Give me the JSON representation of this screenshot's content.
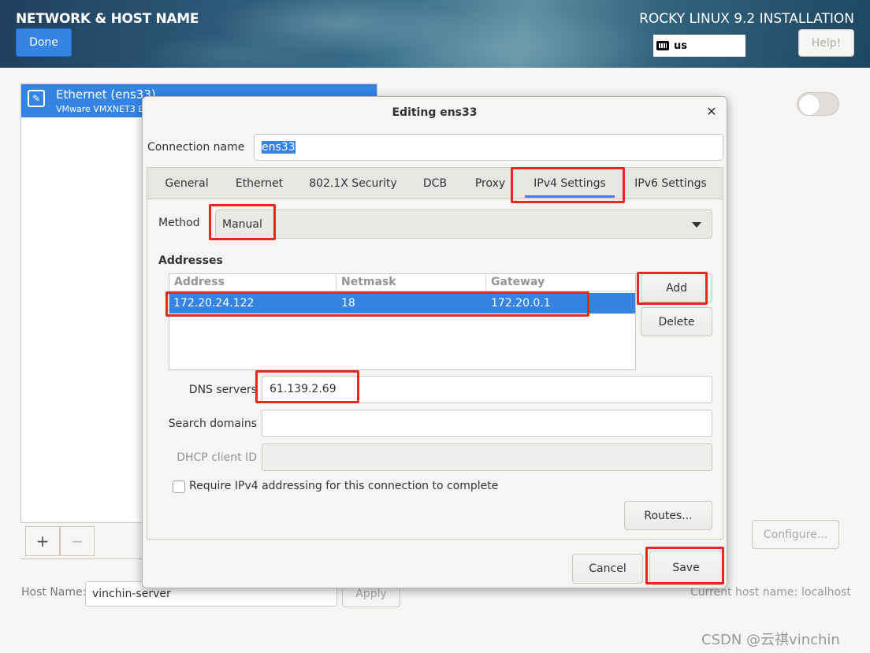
{
  "header": {
    "spoke_title": "NETWORK & HOST NAME",
    "done_label": "Done",
    "install_title": "ROCKY LINUX 9.2 INSTALLATION",
    "keyboard_layout": "us",
    "help_label": "Help!"
  },
  "device_list": {
    "items": [
      {
        "name": "Ethernet (ens33)",
        "description": "VMware VMXNET3 E"
      }
    ],
    "add_label": "+",
    "remove_label": "−"
  },
  "configure_label": "Configure...",
  "hostname": {
    "label": "Host Name:",
    "value": "vinchin-server",
    "apply_label": "Apply",
    "current_label": "Current host name:",
    "current_value": "localhost"
  },
  "dialog": {
    "title": "Editing ens33",
    "close_label": "✕",
    "connection_name_label": "Connection name",
    "connection_name_value": "ens33",
    "tabs": [
      {
        "label": "General"
      },
      {
        "label": "Ethernet"
      },
      {
        "label": "802.1X Security"
      },
      {
        "label": "DCB"
      },
      {
        "label": "Proxy"
      },
      {
        "label": "IPv4 Settings",
        "active": true
      },
      {
        "label": "IPv6 Settings"
      }
    ],
    "ipv4": {
      "method_label": "Method",
      "method_value": "Manual",
      "addresses_heading": "Addresses",
      "columns": [
        "Address",
        "Netmask",
        "Gateway"
      ],
      "rows": [
        {
          "address": "172.20.24.122",
          "netmask": "18",
          "gateway": "172.20.0.1"
        }
      ],
      "add_label": "Add",
      "delete_label": "Delete",
      "dns_label": "DNS servers",
      "dns_value": "61.139.2.69",
      "search_label": "Search domains",
      "search_value": "",
      "dhcp_label": "DHCP client ID",
      "dhcp_value": "",
      "require_label": "Require IPv4 addressing for this connection to complete",
      "require_checked": false,
      "routes_label": "Routes..."
    },
    "cancel_label": "Cancel",
    "save_label": "Save"
  },
  "watermark": "CSDN @云祺vinchin",
  "colors": {
    "accent": "#3584e4",
    "highlight_box": "#e8271e"
  }
}
